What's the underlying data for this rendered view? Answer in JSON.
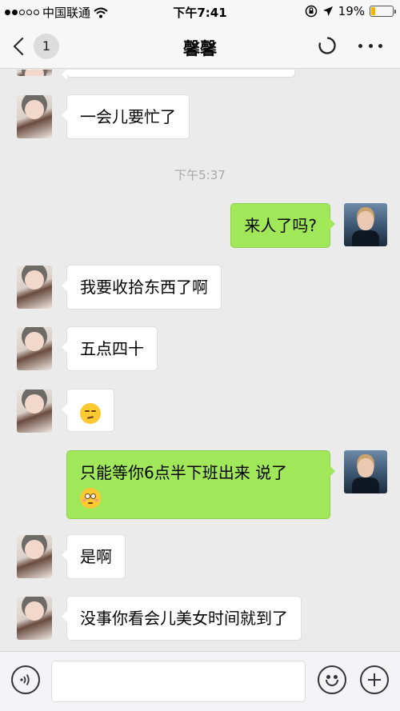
{
  "status_bar": {
    "carrier": "中国联通",
    "time": "下午7:41",
    "battery": "19%",
    "battery_level": 0.19
  },
  "nav": {
    "back_count": "1",
    "title": "馨馨"
  },
  "chat": {
    "messages": [
      {
        "side": "her",
        "text": "一会儿要忙了"
      },
      {
        "time": "下午5:37"
      },
      {
        "side": "me",
        "text": "来人了吗?"
      },
      {
        "side": "her",
        "text": "我要收拾东西了啊"
      },
      {
        "side": "her",
        "text": "五点四十"
      },
      {
        "side": "her",
        "emoji": "unamused-face"
      },
      {
        "side": "me",
        "text": "只能等你6点半下班出来 说了",
        "emoji": "flushed-face"
      },
      {
        "side": "her",
        "text": "是啊"
      },
      {
        "side": "her",
        "text": "没事你看会儿美女时间就到了"
      }
    ]
  },
  "input_bar": {
    "value": "",
    "icons": [
      "voice-icon",
      "emoji-icon",
      "plus-icon"
    ]
  },
  "colors": {
    "my_bubble": "#a0e75a",
    "her_bubble": "#ffffff",
    "chat_bg": "#ebebeb"
  }
}
